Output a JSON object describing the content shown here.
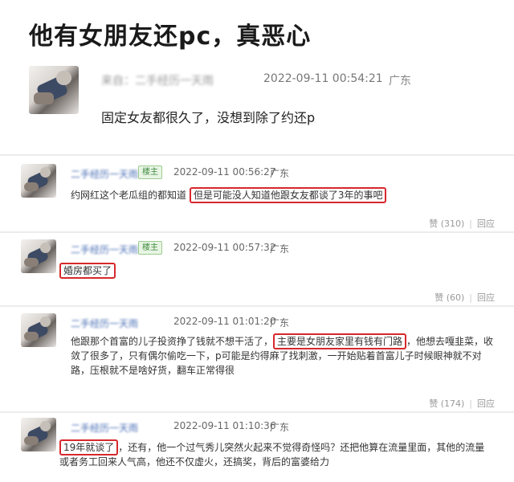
{
  "title": "他有女朋友还pc，真恶心",
  "post": {
    "author": "来自：二手经历一天雨",
    "time": "2022-09-11 00:54:21",
    "location": "广东",
    "content": "固定女友都很久了，没想到除了约还p"
  },
  "comments": [
    {
      "author": "二手经历一天雨",
      "badge": "楼主",
      "time": "2022-09-11 00:56:27",
      "location": "广东",
      "text_a": "约网红这个老瓜组的都知道",
      "text_hl": "但是可能没人知道他跟女友都谈了3年的事吧",
      "like_label": "赞 (310)",
      "reply_label": "回应"
    },
    {
      "author": "二手经历一天雨",
      "badge": "楼主",
      "time": "2022-09-11 00:57:32",
      "location": "广东",
      "text_hl": "婚房都买了",
      "like_label": "赞 (60)",
      "reply_label": "回应"
    },
    {
      "author": "二手经历一天雨",
      "time": "2022-09-11 01:01:20",
      "location": "广东",
      "line1_a": "他跟那个首富的儿子投资挣了钱就不想干活了，",
      "line1_hl": "主要是女朋友家里有钱有门路",
      "line1_b": "，他想去嘎韭菜，收",
      "line2": "敛了很多了，只有偶尔偷吃一下，p可能是约得麻了找刺激，一开始贴着首富儿子时候眼神就不对",
      "line3": "路，压根就不是啥好货，翻车正常得很",
      "like_label": "赞 (174)",
      "reply_label": "回应"
    },
    {
      "author": "二手经历一天雨",
      "time": "2022-09-11 01:10:36",
      "location": "广东",
      "line1_hl": "19年就谈了",
      "line1_b": "，还有，他一个过气秀儿突然火起来不觉得奇怪吗？还把他算在流量里面，其他的流量",
      "line2": "或者务工回来人气高，他还不仅虚火，还搞奖，背后的富婆给力"
    }
  ]
}
